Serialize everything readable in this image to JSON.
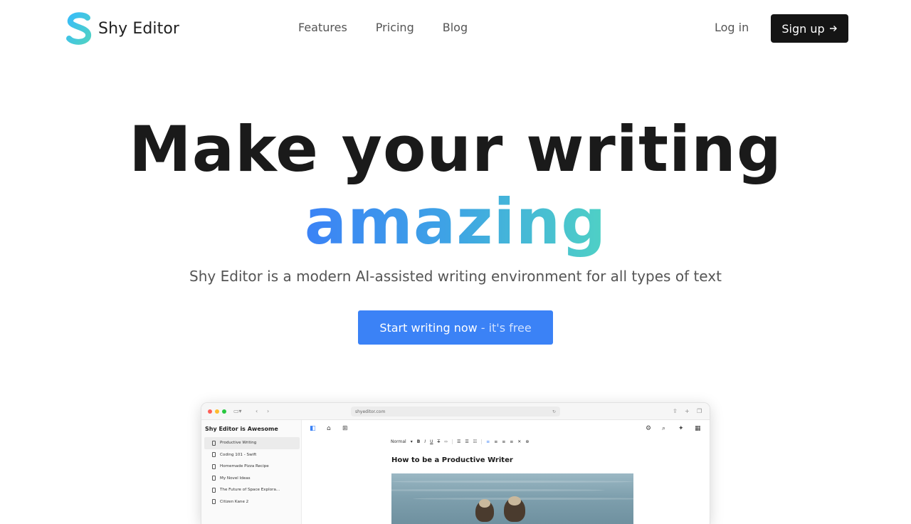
{
  "nav": {
    "brand_name": "Shy Editor",
    "links": [
      "Features",
      "Pricing",
      "Blog"
    ],
    "login_label": "Log in",
    "signup_label": "Sign up",
    "signup_icon": "arrow-right-icon",
    "logo_icon": "s-logo-icon"
  },
  "hero": {
    "title_line1": "Make your writing",
    "title_line2": "amazing",
    "subtitle": "Shy Editor is a modern AI-assisted writing environment for all types of text",
    "cta_main": "Start writing now",
    "cta_suffix": "- it's free"
  },
  "colors": {
    "accent": "#3b82f6",
    "gradient_start": "#3b82f6",
    "gradient_end": "#4fd1c5",
    "signup_bg": "#151515"
  },
  "preview": {
    "url": "shyeditor.com",
    "sidebar_title": "Shy Editor is Awesome",
    "documents": [
      "Productive Writing",
      "Coding 101 - Swift",
      "Homemade Pizza Recipe",
      "My Novel Ideas",
      "The Future of Space Explora...",
      "Citizen Kane 2"
    ],
    "active_document": "Productive Writing",
    "text_style": "Normal",
    "doc_heading": "How to be a Productive Writer"
  }
}
